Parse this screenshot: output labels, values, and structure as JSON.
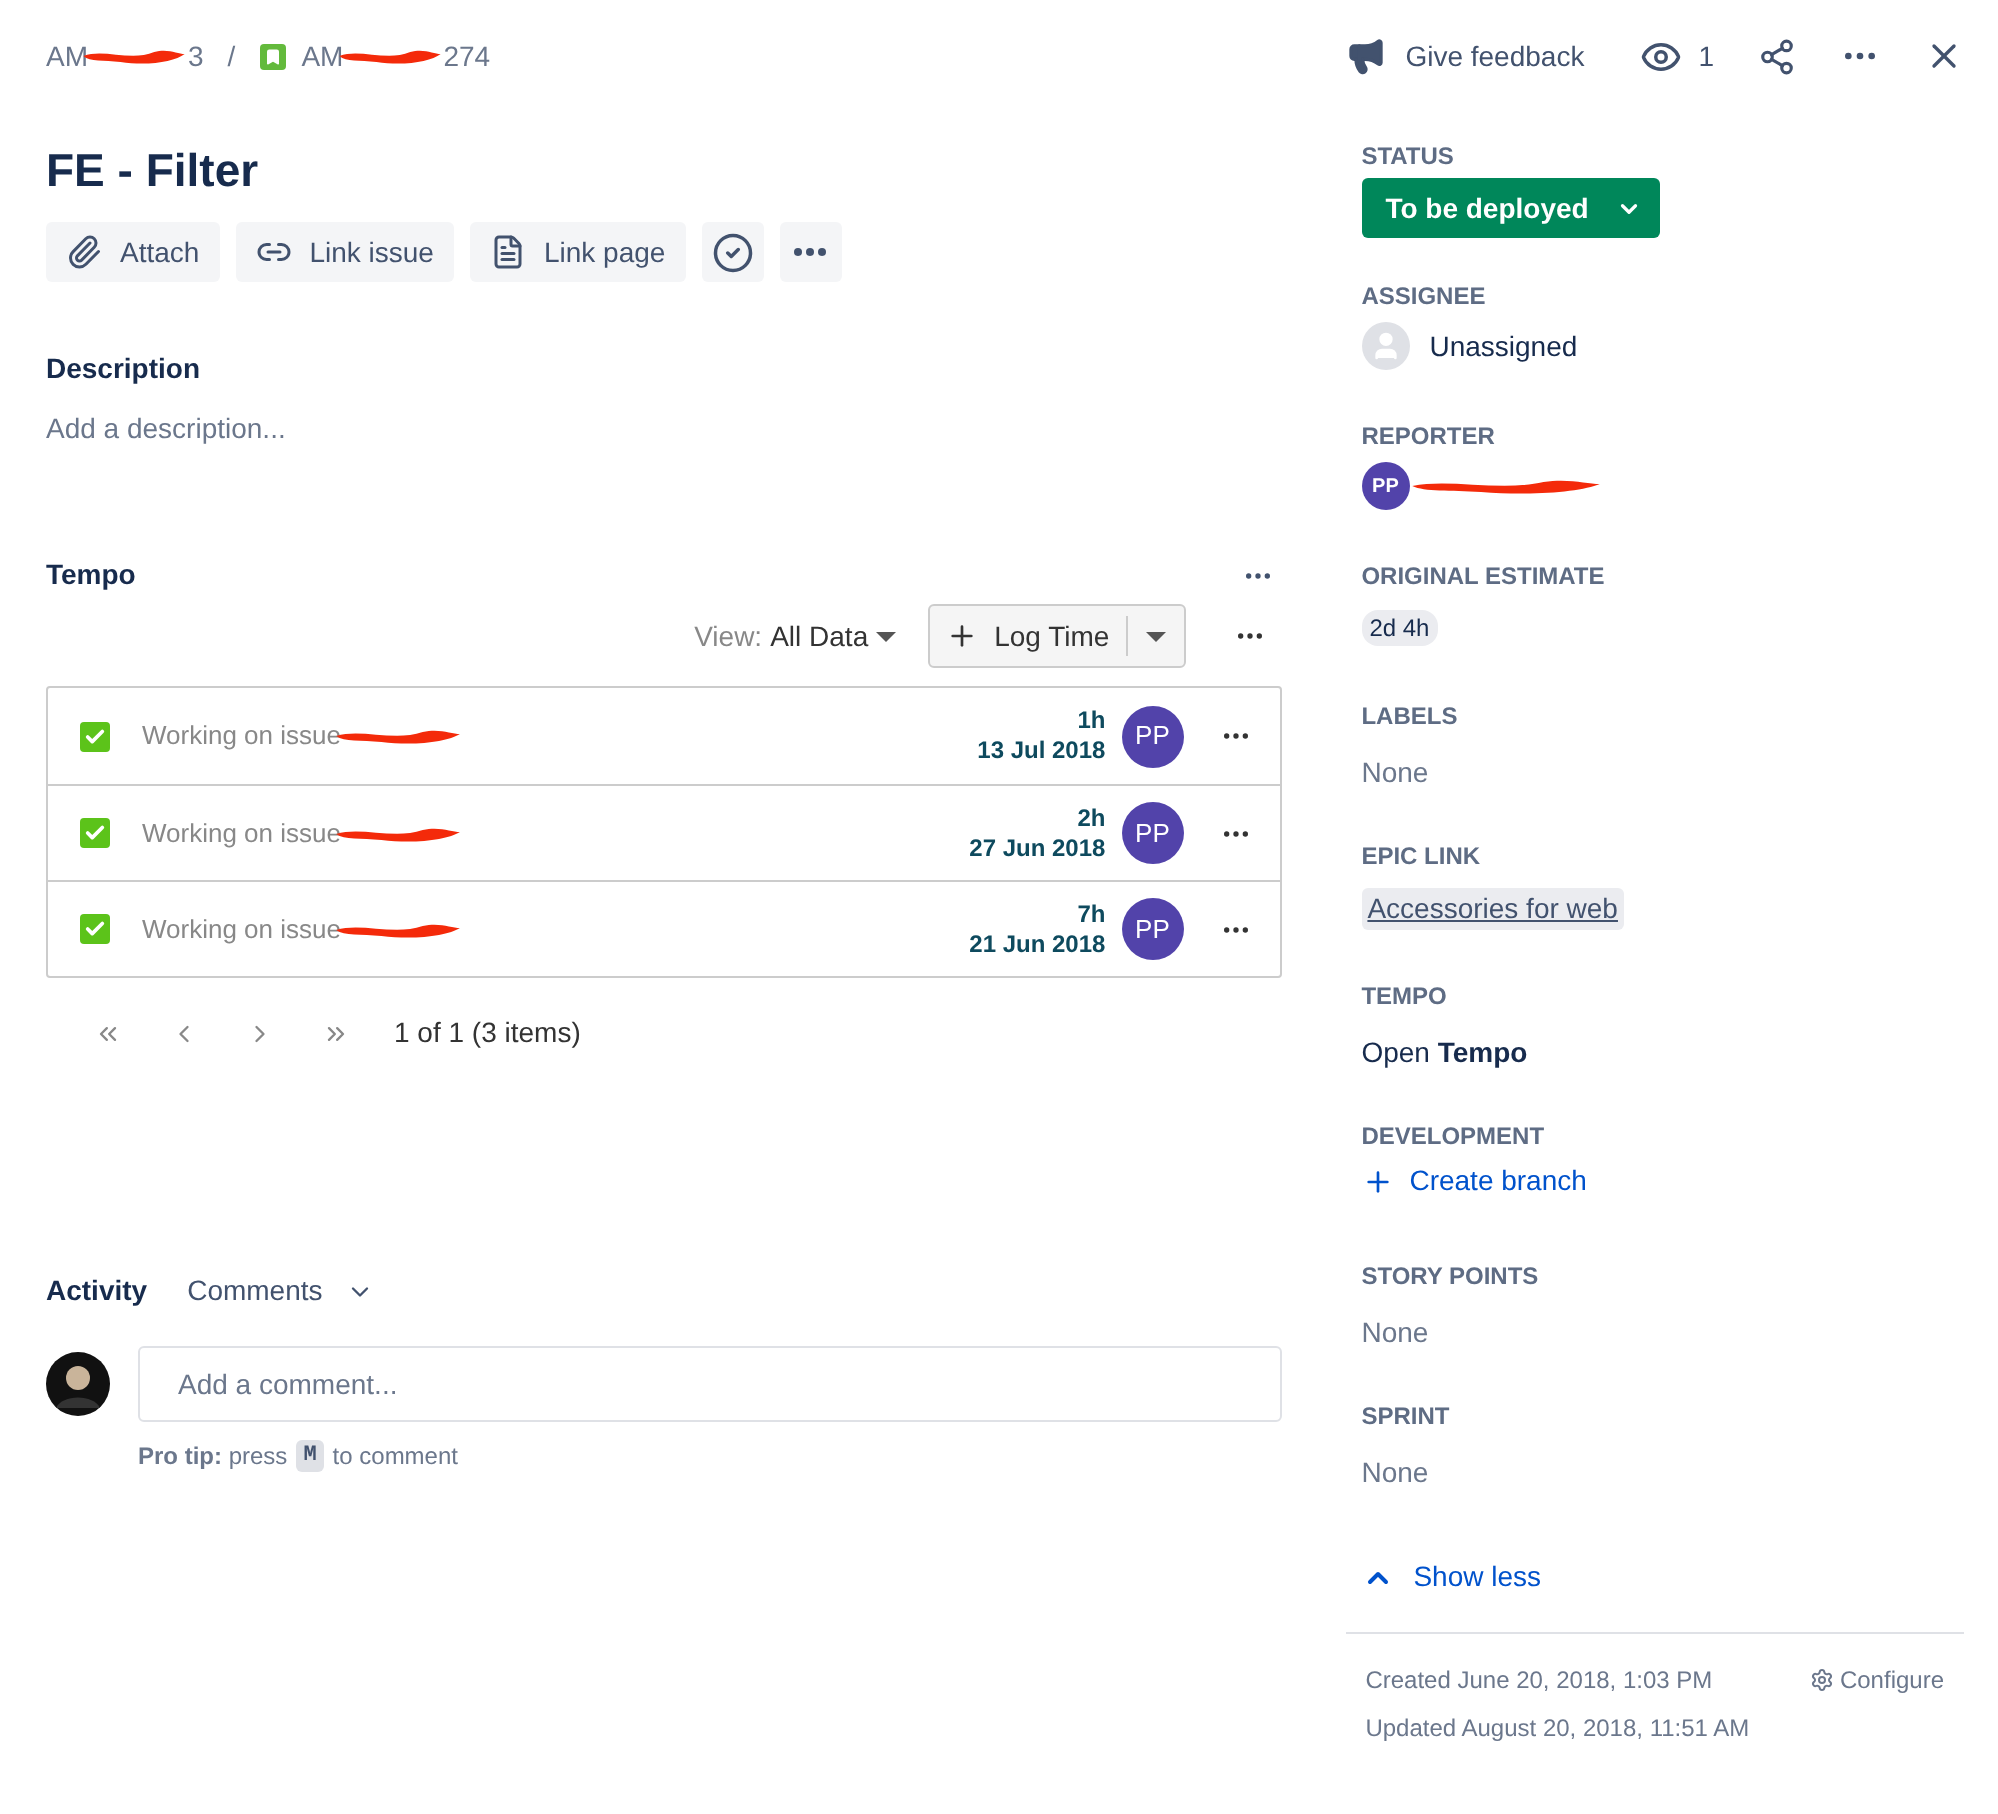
{
  "breadcrumbs": [
    {
      "prefix": "AM",
      "suffix": "3",
      "story_icon": false
    },
    {
      "prefix": "AM",
      "suffix": "274",
      "story_icon": true
    }
  ],
  "breadcrumb_separator": "/",
  "header_actions": {
    "feedback": "Give feedback",
    "watchers": "1"
  },
  "title": "FE - Filter",
  "toolbar": [
    {
      "kind": "attach",
      "label": "Attach"
    },
    {
      "kind": "link",
      "label": "Link issue"
    },
    {
      "kind": "page",
      "label": "Link page"
    },
    {
      "kind": "check"
    },
    {
      "kind": "more"
    }
  ],
  "description": {
    "heading": "Description",
    "placeholder": "Add a description..."
  },
  "tempo": {
    "heading": "Tempo",
    "view_label": "View:",
    "view_value": "All Data",
    "log_button": "Log Time",
    "worklogs": [
      {
        "text": "Working on issue",
        "checked": true,
        "hours": "1h",
        "date": "13 Jul 2018",
        "avatar": "PP"
      },
      {
        "text": "Working on issue",
        "checked": true,
        "hours": "2h",
        "date": "27 Jun 2018",
        "avatar": "PP"
      },
      {
        "text": "Working on issue",
        "checked": true,
        "hours": "7h",
        "date": "21 Jun 2018",
        "avatar": "PP"
      }
    ],
    "pagination": "1 of 1 (3 items)"
  },
  "activity": {
    "heading": "Activity",
    "filter": "Comments",
    "comment_placeholder": "Add a comment...",
    "pro_tip": "**Pro tip:** press",
    "key": "M",
    "pro_tip_end": "to comment"
  },
  "fields": [
    {
      "kind": "status",
      "label": "STATUS",
      "value": "To be deployed"
    },
    {
      "kind": "user",
      "label": "ASSIGNEE",
      "value": "Unassigned"
    },
    {
      "kind": "reporter",
      "label": "REPORTER",
      "avatar": "PP"
    },
    {
      "kind": "chip",
      "label": "ORIGINAL ESTIMATE",
      "value": "2d 4h"
    },
    {
      "kind": "none",
      "label": "LABELS",
      "value": "None"
    },
    {
      "kind": "epic",
      "label": "EPIC LINK",
      "value": "Accessories for web"
    },
    {
      "kind": "rich",
      "label": "TEMPO",
      "value": "Open **Tempo**"
    },
    {
      "kind": "action",
      "label": "DEVELOPMENT",
      "value": "Create branch"
    },
    {
      "kind": "none",
      "label": "STORY POINTS",
      "value": "None"
    },
    {
      "kind": "none",
      "label": "SPRINT",
      "value": "None"
    }
  ],
  "show_less": "Show less",
  "footer": {
    "created": "Created June 20, 2018, 1:03 PM",
    "updated": "Updated August 20, 2018, 11:51 AM",
    "configure": "Configure"
  }
}
